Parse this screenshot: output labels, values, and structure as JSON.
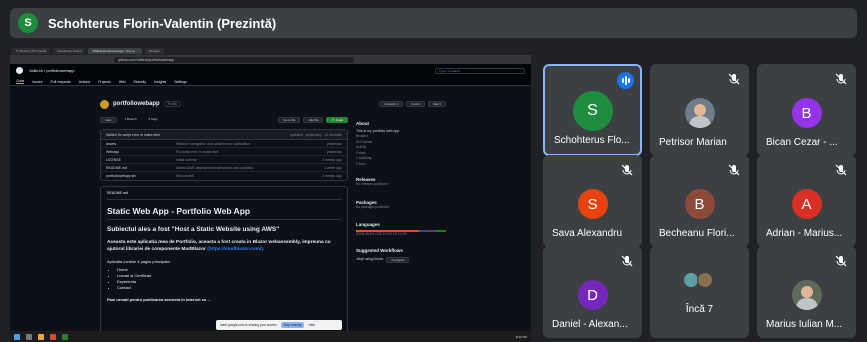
{
  "meeting": {
    "presenter_initial": "S",
    "title": "Schohterus Florin-Valentin (Prezintă)"
  },
  "screen": {
    "browser_tabs": [
      "IT Student | PG Global",
      "CloudFront Global",
      "Wallich/portfoliowebapp: This is ...",
      "Webapp"
    ],
    "address": "github.com/Valikrch/portfoliowebapp",
    "gh_breadcrumb": "Valikrch / portfoliowebapp",
    "gh_search": "Type / to search",
    "gh_nav": [
      "Code",
      "Issues",
      "Pull requests",
      "Actions",
      "Projects",
      "Wiki",
      "Security",
      "Insights",
      "Settings"
    ],
    "repo_name": "portfoliowebapp",
    "repo_visibility": "Public",
    "repo_buttons": [
      "Unwatch 1",
      "Fork 0",
      "Star 0"
    ],
    "branch": "main",
    "branches": "1 Branch",
    "tags": "0 Tags",
    "go_to_file": "Go to file",
    "add_file": "Add file",
    "code_btn": "<> Code",
    "commit_line": "Wallich fix script error in index.html",
    "commit_meta": "updated · yesterday · 13 commits",
    "files": [
      {
        "name": "assets",
        "msg": "Refactor navigation and added error notification",
        "when": "yesterday"
      },
      {
        "name": "Webapp",
        "msg": "Fix script error in index.html",
        "when": "yesterday"
      },
      {
        "name": "LICENSE",
        "msg": "Initial commit",
        "when": "2 weeks ago"
      },
      {
        "name": "README.md",
        "msg": "Added AWS deployment instructions and updated",
        "when": "1 week ago"
      },
      {
        "name": "portfoliowebapp.sln",
        "msg": "first commit",
        "when": "2 weeks ago"
      }
    ],
    "readme_label": "README.md",
    "readme_h1": "Static Web App - Portfolio Web App",
    "readme_h2": "Subiectul ales a fost \"Host a Static Website using AWS\"",
    "readme_p1": "Aceasta este aplicatia mea de Portfolio, aceasta a fost creata in Blazor webassembly, impreuna cu ajutorul librariei de componente MudBlazor",
    "readme_link": "(https://mudblazor.com/).",
    "readme_p2": "Aplicatia contine 4 pagini principale:",
    "readme_list": [
      "Home",
      "Lucrari si Certificari",
      "Experienta",
      "Contact"
    ],
    "readme_p3": "Pasi urmati pentru publicarea acesteia in internet cu ...",
    "about_title": "About",
    "about_text": "This is my portfolio web app",
    "about_meta": [
      "Readme",
      "MIT license",
      "Activity",
      "0 stars",
      "1 watching",
      "0 forks"
    ],
    "releases_title": "Releases",
    "releases_text": "No releases published",
    "packages_title": "Packages",
    "packages_text": "No packages published",
    "languages_title": "Languages",
    "languages": "HTML 69.8%  CSS 19.2%  C# 11.0%",
    "workflows_title": "Suggested Workflows",
    "workflow_item": "Jekyll using Docker",
    "workflow_btn": "Configure",
    "share_text": "meet.google.com is sharing your screen",
    "share_stop": "Stop sharing",
    "share_hide": "Hide",
    "clock": "8:02 PM",
    "colors": {
      "lang_html": "#e34c26",
      "lang_css": "#563d7c",
      "lang_cs": "#178600"
    }
  },
  "participants": [
    {
      "initial": "S",
      "name": "Schohterus Flo...",
      "color": "#1e8e3e",
      "speaking": true,
      "muted": false
    },
    {
      "initial": "",
      "name": "Petrisor Marian",
      "color": "#6d7b8a",
      "photo": true,
      "muted": true
    },
    {
      "initial": "B",
      "name": "Bican Cezar - ...",
      "color": "#9334e6",
      "muted": true
    },
    {
      "initial": "S",
      "name": "Sava Alexandru",
      "color": "#e8430f",
      "muted": true
    },
    {
      "initial": "B",
      "name": "Becheanu Flori...",
      "color": "#8d4a3b",
      "muted": true
    },
    {
      "initial": "A",
      "name": "Adrian - Marius...",
      "color": "#d93025",
      "muted": true
    },
    {
      "initial": "D",
      "name": "Daniel - Alexan...",
      "color": "#7627bb",
      "muted": true
    },
    {
      "more": true,
      "name": "Încă 7"
    },
    {
      "initial": "",
      "name": "Marius Iulian M...",
      "color": "#5f6b5a",
      "photo": true,
      "muted": true
    }
  ]
}
